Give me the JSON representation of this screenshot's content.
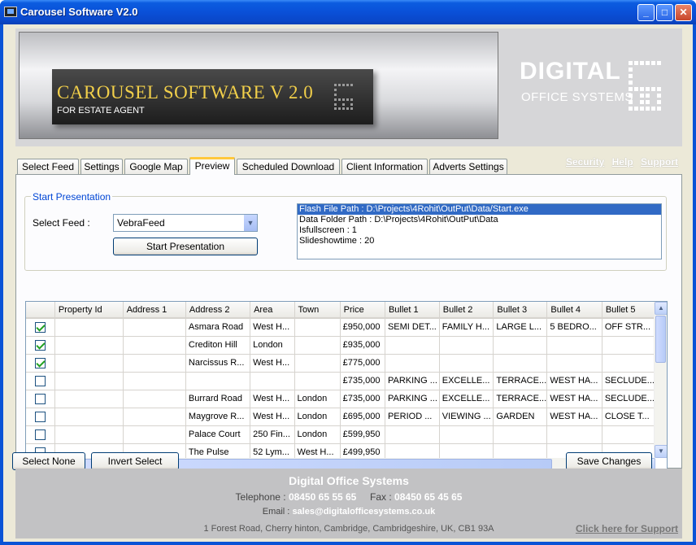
{
  "window": {
    "title": "Carousel Software V2.0"
  },
  "banner": {
    "title": "CAROUSEL SOFTWARE V 2.0",
    "subtitle": "FOR ESTATE AGENT",
    "brand_line1": "DIGITAL",
    "brand_line2": "OFFICE SYSTEMS"
  },
  "tabs": [
    "Select Feed",
    "Settings",
    "Google Map",
    "Preview",
    "Scheduled Download",
    "Client Information",
    "Adverts Settings"
  ],
  "active_tab": "Preview",
  "top_links": [
    "Security",
    "Help",
    "Support"
  ],
  "presentation": {
    "group_label": "Start Presentation",
    "select_feed_label": "Select Feed :",
    "select_feed_value": "VebraFeed",
    "start_button": "Start Presentation",
    "info_lines": [
      "Flash File Path : D:\\Projects\\4Rohit\\OutPut\\Data/Start.exe",
      "Data Folder Path : D:\\Projects\\4Rohit\\OutPut\\Data",
      "Isfullscreen : 1",
      "Slideshowtime : 20"
    ]
  },
  "grid": {
    "columns": [
      "",
      "Property Id",
      "Address 1",
      "Address 2",
      "Area",
      "Town",
      "Price",
      "Bullet 1",
      "Bullet 2",
      "Bullet 3",
      "Bullet 4",
      "Bullet 5"
    ],
    "rows": [
      {
        "checked": true,
        "cells": [
          "",
          "",
          "Asmara Road",
          "West H...",
          "",
          "£950,000",
          "SEMI DET...",
          "FAMILY H...",
          "LARGE L...",
          "5 BEDRO...",
          "OFF STR..."
        ]
      },
      {
        "checked": true,
        "cells": [
          "",
          "",
          "Crediton Hill",
          "London",
          "",
          "£935,000",
          "",
          "",
          "",
          "",
          ""
        ]
      },
      {
        "checked": true,
        "cells": [
          "",
          "",
          "Narcissus R...",
          "West H...",
          "",
          "£775,000",
          "",
          "",
          "",
          "",
          ""
        ]
      },
      {
        "checked": false,
        "cells": [
          "",
          "",
          "",
          "",
          "",
          "£735,000",
          "PARKING ...",
          "EXCELLE...",
          "TERRACE...",
          "WEST HA...",
          "SECLUDE..."
        ]
      },
      {
        "checked": false,
        "cells": [
          "",
          "",
          "Burrard Road",
          "West H...",
          "London",
          "£735,000",
          "PARKING ...",
          "EXCELLE...",
          "TERRACE...",
          "WEST HA...",
          "SECLUDE..."
        ]
      },
      {
        "checked": false,
        "cells": [
          "",
          "",
          "Maygrove R...",
          "West H...",
          "London",
          "£695,000",
          "PERIOD ...",
          "VIEWING ...",
          "GARDEN",
          "WEST HA...",
          "CLOSE T..."
        ]
      },
      {
        "checked": false,
        "cells": [
          "",
          "",
          "Palace Court",
          "250 Fin...",
          "London",
          "£599,950",
          "",
          "",
          "",
          "",
          ""
        ]
      },
      {
        "checked": false,
        "cells": [
          "",
          "",
          "The Pulse",
          "52 Lym...",
          "West H...",
          "£499,950",
          "",
          "",
          "",
          "",
          ""
        ]
      }
    ]
  },
  "actions": {
    "select_none": "Select None",
    "invert_select": "Invert Select",
    "save_changes": "Save Changes"
  },
  "footer": {
    "company": "Digital Office Systems",
    "telephone_label": "Telephone :",
    "telephone": "08450 65 55 65",
    "fax_label": "Fax :",
    "fax": "08450 65 45 65",
    "email_label": "Email :",
    "email": "sales@digitalofficesystems.co.uk",
    "address": "1 Forest Road, Cherry hinton, Cambridge, Cambridgeshire, UK, CB1 93A",
    "support_link": "Click here for Support"
  }
}
